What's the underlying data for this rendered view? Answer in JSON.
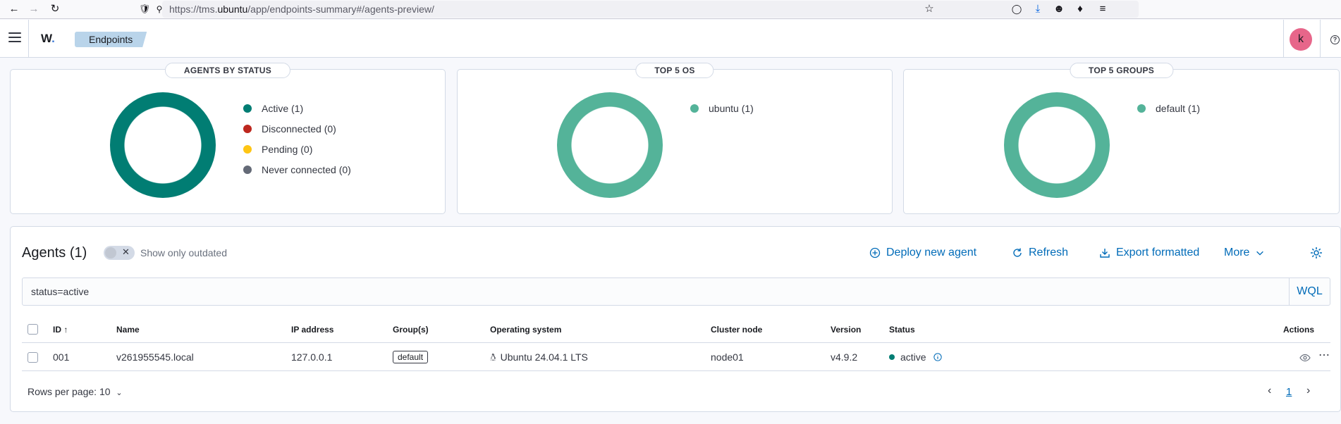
{
  "browser": {
    "url_prefix": "https://tms.",
    "url_domain": "ubuntu",
    "url_path": "/app/endpoints-summary#/agents-preview/"
  },
  "header": {
    "logo": "W",
    "breadcrumb": "Endpoints",
    "avatar_letter": "k"
  },
  "cards": {
    "status": {
      "title": "AGENTS BY STATUS",
      "legend": [
        {
          "label": "Active (1)",
          "color": "#017d73"
        },
        {
          "label": "Disconnected (0)",
          "color": "#bd271e"
        },
        {
          "label": "Pending (0)",
          "color": "#fec514"
        },
        {
          "label": "Never connected (0)",
          "color": "#646a77"
        }
      ]
    },
    "os": {
      "title": "TOP 5 OS",
      "legend": [
        {
          "label": "ubuntu (1)",
          "color": "#54b399"
        }
      ]
    },
    "groups": {
      "title": "TOP 5 GROUPS",
      "legend": [
        {
          "label": "default (1)",
          "color": "#54b399"
        }
      ]
    }
  },
  "agents": {
    "title": "Agents (1)",
    "toggle_label": "Show only outdated",
    "actions": {
      "deploy": "Deploy new agent",
      "refresh": "Refresh",
      "export": "Export formatted",
      "more": "More"
    },
    "search_value": "status=active",
    "wql": "WQL",
    "columns": {
      "id": "ID",
      "name": "Name",
      "ip": "IP address",
      "groups": "Group(s)",
      "os": "Operating system",
      "cluster": "Cluster node",
      "version": "Version",
      "status": "Status",
      "actions": "Actions"
    },
    "rows": [
      {
        "id": "001",
        "name": "v261955545.local",
        "ip": "127.0.0.1",
        "group": "default",
        "os": "Ubuntu 24.04.1 LTS",
        "cluster": "node01",
        "version": "v4.9.2",
        "status": "active"
      }
    ],
    "rows_per_page": "Rows per page: 10",
    "page": "1"
  }
}
